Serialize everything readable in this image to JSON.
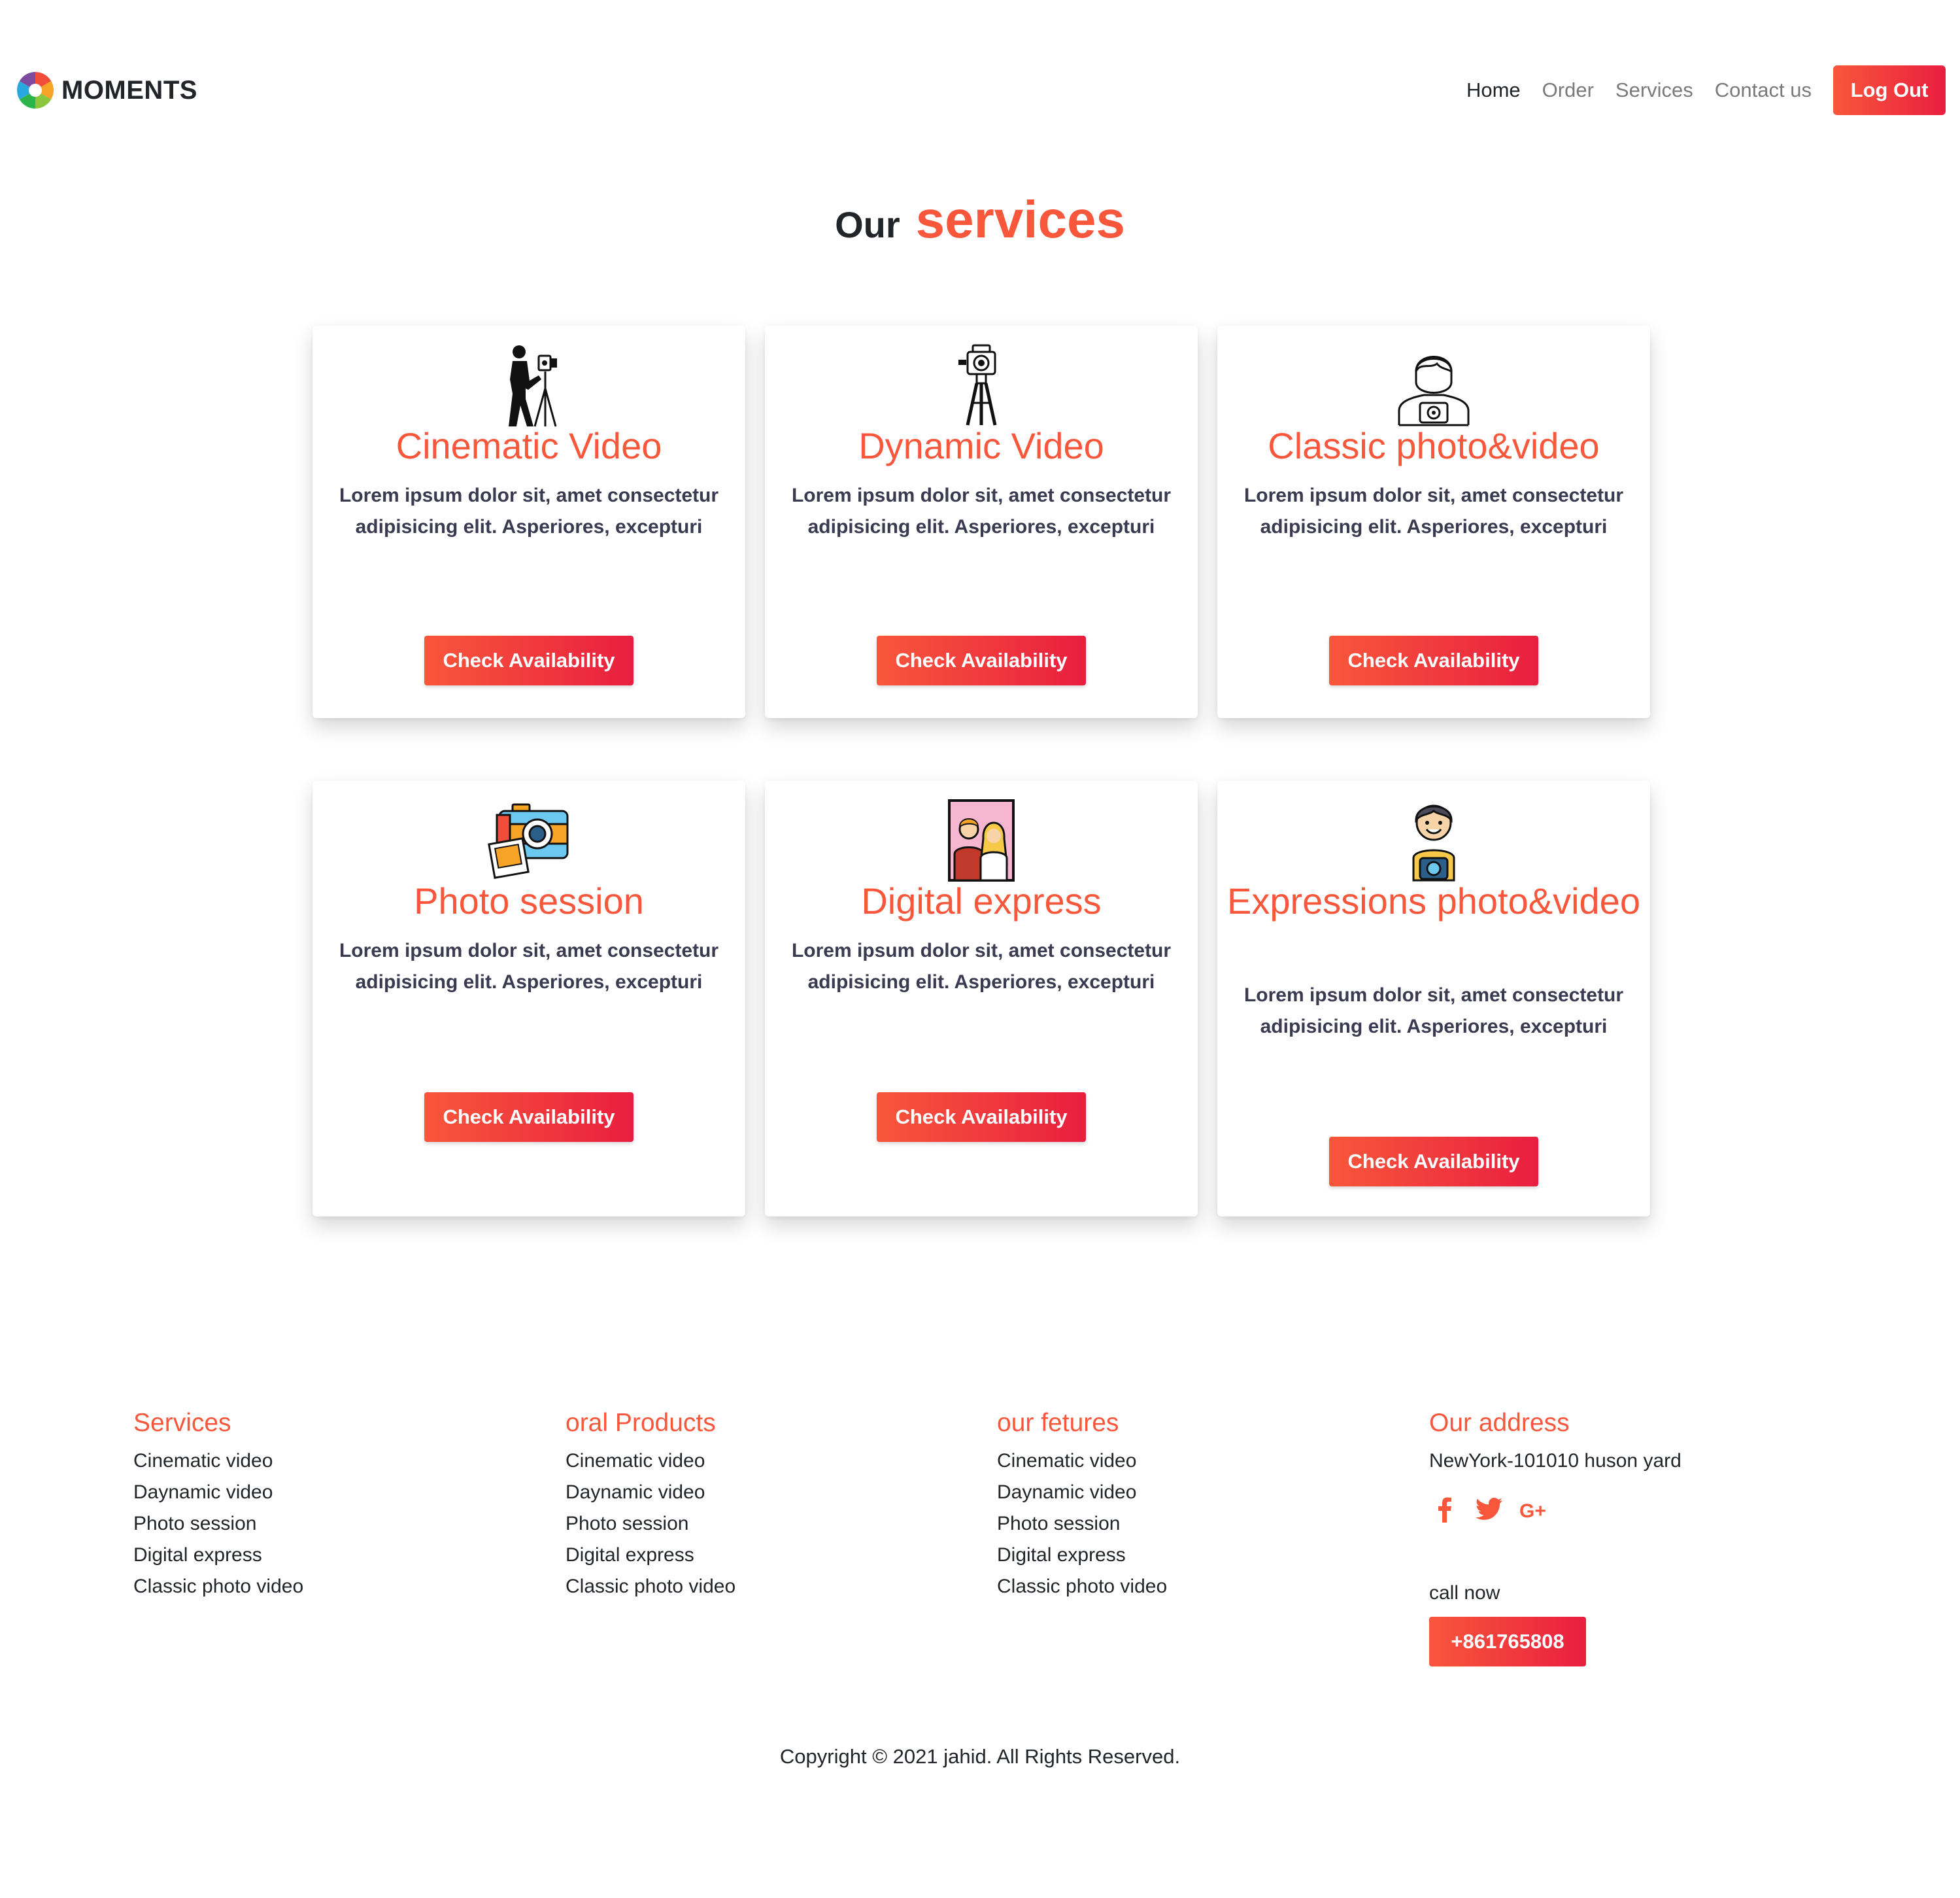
{
  "brand": {
    "name": "MOMENTS",
    "logo_icon": "moments-logo-icon"
  },
  "nav": {
    "links": [
      "Home",
      "Order",
      "Services",
      "Contact us"
    ],
    "logout_label": "Log Out"
  },
  "section": {
    "title_prefix": "Our",
    "title_highlight": "services"
  },
  "cards": [
    {
      "icon": "videographer-icon",
      "title": "Cinematic Video",
      "desc": "Lorem ipsum dolor sit, amet consectetur adipisicing elit. Asperiores, excepturi",
      "button": "Check Availability"
    },
    {
      "icon": "camera-tripod-icon",
      "title": "Dynamic Video",
      "desc": "Lorem ipsum dolor sit, amet consectetur adipisicing elit. Asperiores, excepturi",
      "button": "Check Availability"
    },
    {
      "icon": "photographer-icon",
      "title": "Classic photo&video",
      "desc": "Lorem ipsum dolor sit, amet consectetur adipisicing elit. Asperiores, excepturi",
      "button": "Check Availability"
    },
    {
      "icon": "camera-photos-icon",
      "title": "Photo session",
      "desc": "Lorem ipsum dolor sit, amet consectetur adipisicing elit. Asperiores, excepturi",
      "button": "Check Availability"
    },
    {
      "icon": "couple-portrait-icon",
      "title": "Digital express",
      "desc": "Lorem ipsum dolor sit, amet consectetur adipisicing elit. Asperiores, excepturi",
      "button": "Check Availability"
    },
    {
      "icon": "cartoon-photographer-icon",
      "title": "Expressions photo&video",
      "desc": "Lorem ipsum dolor sit, amet consectetur adipisicing elit. Asperiores, excepturi",
      "button": "Check Availability"
    }
  ],
  "footer": {
    "columns": [
      {
        "heading": "Services",
        "items": [
          "Cinematic video",
          "Daynamic video",
          "Photo session",
          "Digital express",
          "Classic photo video"
        ]
      },
      {
        "heading": "oral Products",
        "items": [
          "Cinematic video",
          "Daynamic video",
          "Photo session",
          "Digital express",
          "Classic photo video"
        ]
      },
      {
        "heading": "our fetures",
        "items": [
          "Cinematic video",
          "Daynamic video",
          "Photo session",
          "Digital express",
          "Classic photo video"
        ]
      }
    ],
    "address": {
      "heading": "Our address",
      "line": "NewYork-101010 huson yard",
      "social_icons": [
        "facebook-icon",
        "twitter-icon",
        "google-plus-icon"
      ],
      "call_label": "call now",
      "phone": "+861765808"
    },
    "copyright": "Copyright © 2021 jahid. All Rights Reserved."
  },
  "colors": {
    "accent": "#f8573b",
    "accent_dark": "#e91e3f",
    "text": "#212529",
    "muted": "#7a7a7a",
    "desc": "#3a3a50"
  }
}
